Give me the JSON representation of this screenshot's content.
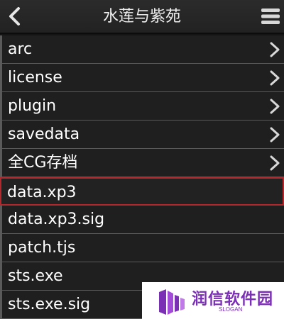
{
  "header": {
    "title": "水莲与紫苑",
    "back_icon": "chevron-left-icon",
    "menu_icon": "hamburger-menu-icon"
  },
  "files": [
    {
      "name": "arc",
      "type": "folder"
    },
    {
      "name": "license",
      "type": "folder"
    },
    {
      "name": "plugin",
      "type": "folder"
    },
    {
      "name": "savedata",
      "type": "folder"
    },
    {
      "name": "全CG存档",
      "type": "folder"
    },
    {
      "name": "data.xp3",
      "type": "file",
      "selected": true
    },
    {
      "name": "data.xp3.sig",
      "type": "file"
    },
    {
      "name": "patch.tjs",
      "type": "file"
    },
    {
      "name": "sts.exe",
      "type": "file"
    },
    {
      "name": "sts.exe.sig",
      "type": "file"
    }
  ],
  "watermark": {
    "name": "润信软件园",
    "slogan": "SLOGAN"
  },
  "colors": {
    "background": "#141414",
    "row_background": "#1f1f1f",
    "selected_border": "#b3282c",
    "watermark_text": "#7a2fb4"
  }
}
